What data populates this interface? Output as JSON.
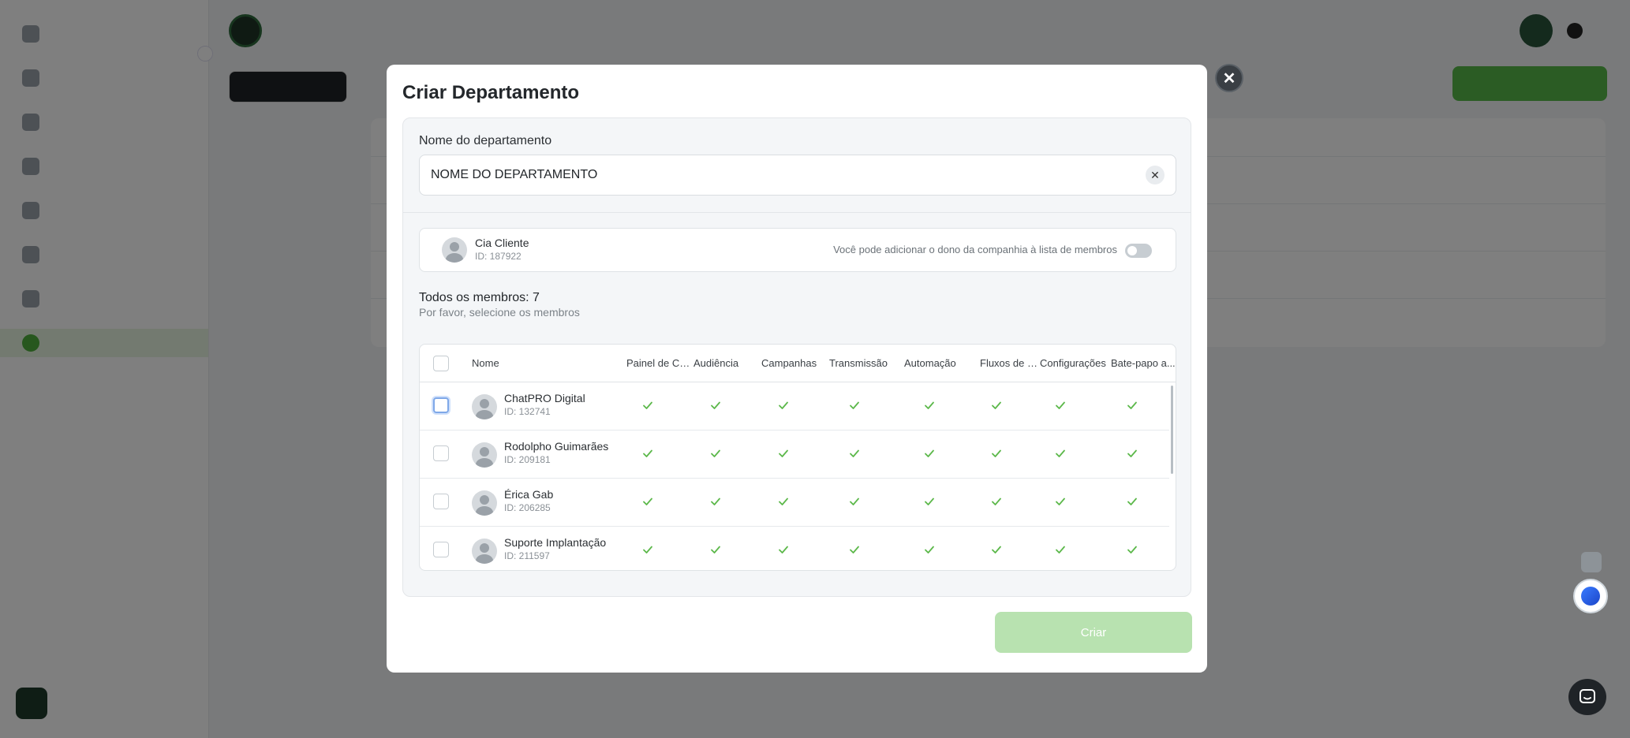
{
  "modal": {
    "title": "Criar Departamento",
    "close_glyph": "✕",
    "field_label": "Nome do departamento",
    "name_value": "NOME DO DEPARTAMENTO",
    "clear_glyph": "✕",
    "owner": {
      "name": "Cia Cliente",
      "id": "ID: 187922",
      "hint": "Você pode adicionar o dono da companhia à lista de membros",
      "toggle_on": false
    },
    "members_title": "Todos os membros: 7",
    "members_subtitle": "Por favor, selecione os membros",
    "columns": [
      "Nome",
      "Painel de Co...",
      "Audiência",
      "Campanhas",
      "Transmissão",
      "Automação",
      "Fluxos de c...",
      "Configurações",
      "Bate-papo a..."
    ],
    "members": [
      {
        "name": "ChatPRO Digital",
        "id": "ID: 132741",
        "permissions": [
          true,
          true,
          true,
          true,
          true,
          true,
          true,
          true
        ]
      },
      {
        "name": "Rodolpho Guimarães",
        "id": "ID: 209181",
        "permissions": [
          true,
          true,
          true,
          true,
          true,
          true,
          true,
          true
        ]
      },
      {
        "name": "Érica Gab",
        "id": "ID: 206285",
        "permissions": [
          true,
          true,
          true,
          true,
          true,
          true,
          true,
          true
        ]
      },
      {
        "name": "Suporte Implantação",
        "id": "ID: 211597",
        "permissions": [
          true,
          true,
          true,
          true,
          true,
          true,
          true,
          true
        ]
      }
    ],
    "create_label": "Criar"
  },
  "colors": {
    "accent_green": "#4fae3c",
    "create_disabled": "#b8e2b0",
    "check": "#5cb84a"
  },
  "icons": {
    "check": "check-icon",
    "avatar": "user-placeholder-icon",
    "chat": "chat-bubble-icon"
  }
}
